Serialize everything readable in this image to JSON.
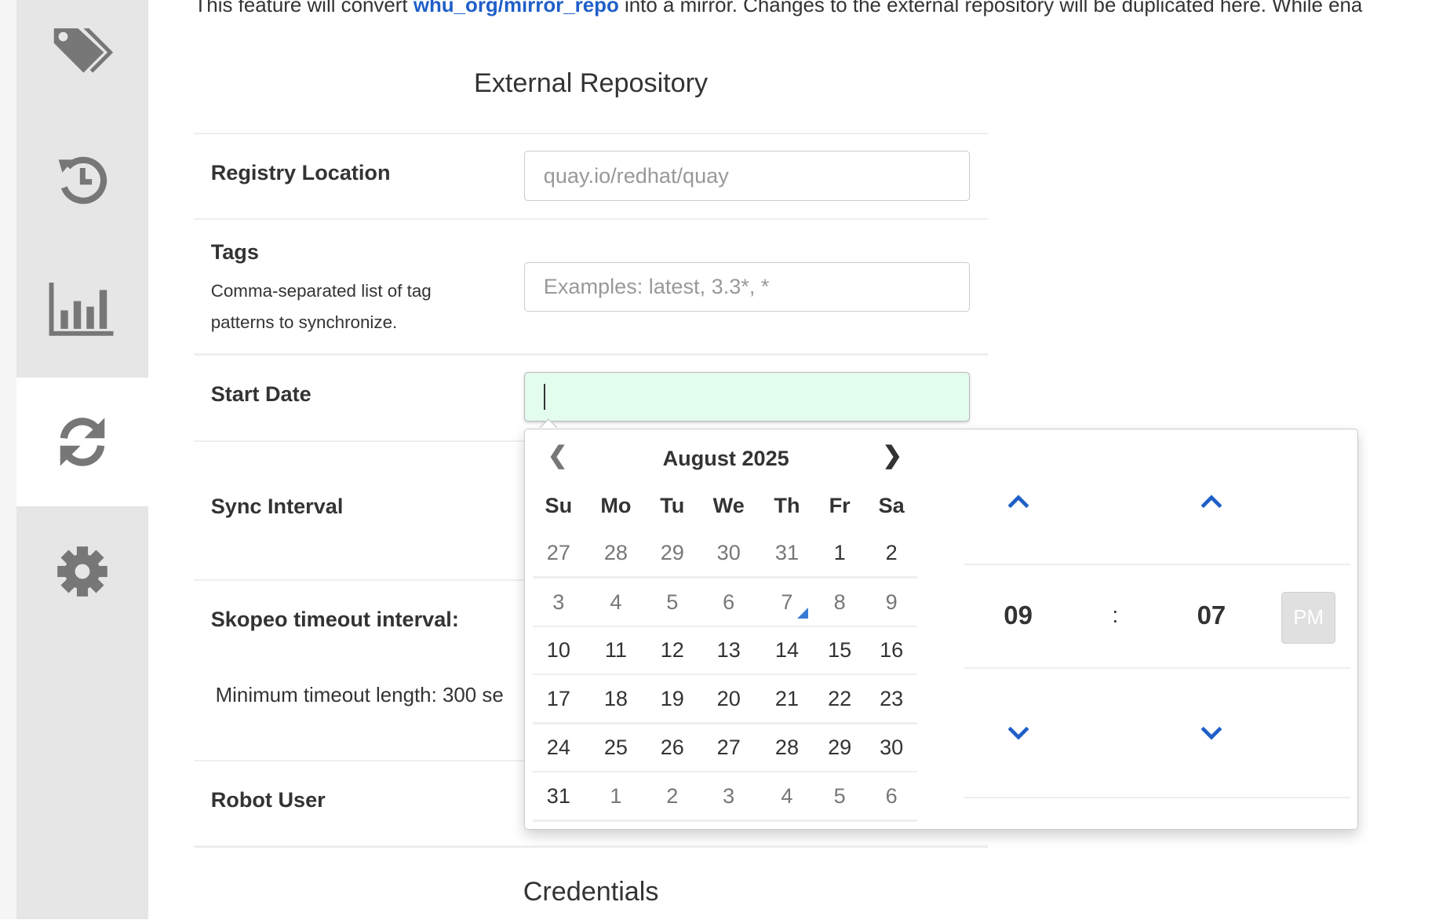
{
  "intro": {
    "prefix": "This feature will convert ",
    "repo_link": "whu_org/mirror_repo",
    "suffix": " into a mirror. Changes to the external repository will be duplicated here. While ena"
  },
  "sidebar": {
    "items": [
      {
        "icon": "tags-icon",
        "active": false
      },
      {
        "icon": "history-icon",
        "active": false
      },
      {
        "icon": "usage-chart-icon",
        "active": false
      },
      {
        "icon": "mirroring-sync-icon",
        "active": true
      },
      {
        "icon": "settings-gear-icon",
        "active": false
      }
    ]
  },
  "form": {
    "section_title": "External Repository",
    "registry_location": {
      "label": "Registry Location",
      "placeholder": "quay.io/redhat/quay",
      "value": ""
    },
    "tags": {
      "label": "Tags",
      "help": "Comma-separated list of tag patterns to synchronize.",
      "placeholder": "Examples: latest, 3.3*, *",
      "value": ""
    },
    "start_date": {
      "label": "Start Date",
      "value": ""
    },
    "sync_interval": {
      "label": "Sync Interval"
    },
    "skopeo_timeout": {
      "label": "Skopeo timeout interval:",
      "help": "Minimum timeout length: 300 se"
    },
    "robot_user": {
      "label": "Robot User"
    },
    "credentials_title": "Credentials"
  },
  "datepicker": {
    "month_title": "August 2025",
    "prev_icon": "chevron-left-icon",
    "next_icon": "chevron-right-icon",
    "weekdays": [
      "Su",
      "Mo",
      "Tu",
      "We",
      "Th",
      "Fr",
      "Sa"
    ],
    "weeks": [
      [
        "27",
        "28",
        "29",
        "30",
        "31",
        "1",
        "2"
      ],
      [
        "3",
        "4",
        "5",
        "6",
        "7",
        "8",
        "9"
      ],
      [
        "10",
        "11",
        "12",
        "13",
        "14",
        "15",
        "16"
      ],
      [
        "17",
        "18",
        "19",
        "20",
        "21",
        "22",
        "23"
      ],
      [
        "24",
        "25",
        "26",
        "27",
        "28",
        "29",
        "30"
      ],
      [
        "31",
        "1",
        "2",
        "3",
        "4",
        "5",
        "6"
      ]
    ],
    "today": "7",
    "time": {
      "hour": "09",
      "separator": ":",
      "minute": "07",
      "period": "PM"
    },
    "accent_color": "#1f5fc8"
  }
}
